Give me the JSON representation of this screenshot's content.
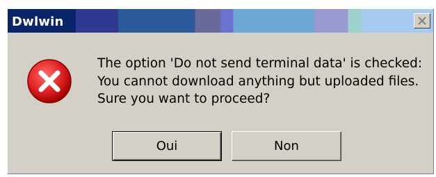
{
  "window": {
    "title": "Dwlwin",
    "close_glyph": "✕"
  },
  "icon": {
    "type": "error-icon",
    "color": "#d42020"
  },
  "message": {
    "lines": [
      "The option 'Do not send terminal data' is checked:",
      "You cannot download anything but uploaded files.",
      "Sure you want to proceed?"
    ]
  },
  "buttons": {
    "yes_label": "Oui",
    "no_label": "Non"
  }
}
